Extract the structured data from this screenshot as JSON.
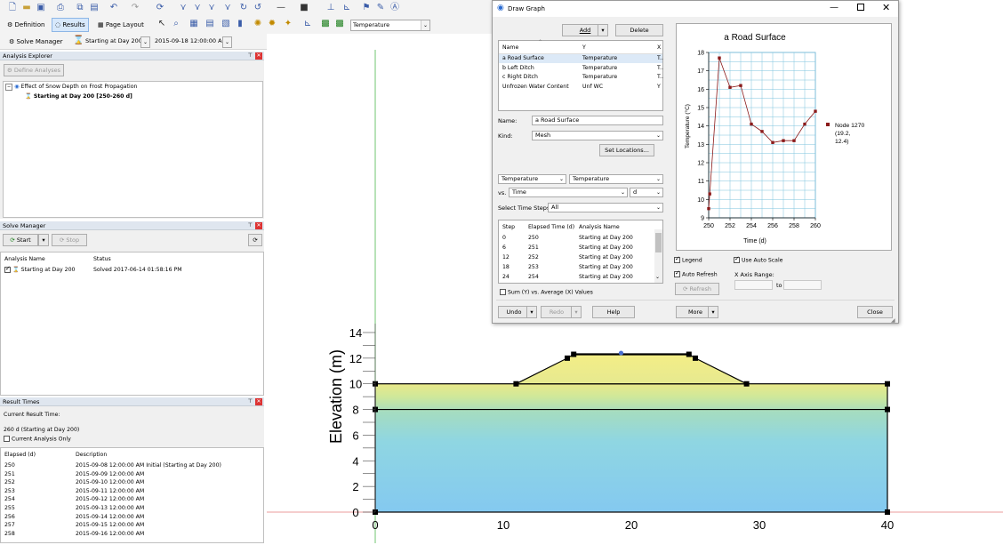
{
  "toolbar": {
    "definition_label": "Definition",
    "results_label": "Results",
    "page_layout_label": "Page Layout",
    "contour_combo_value": "Temperature",
    "solve_manager_label": "Solve Manager",
    "analysis_combo_value": "Starting at Day 200",
    "time_combo_value": "2015-09-18 12:00:00 A..."
  },
  "analysis_explorer": {
    "title": "Analysis Explorer",
    "define_button": "Define Analyses",
    "project_name": "Effect of Snow Depth on Frost Propagation",
    "analysis_name": "Starting at Day 200 [250-260 d]"
  },
  "solve_manager": {
    "title": "Solve Manager",
    "start_label": "Start",
    "stop_label": "Stop",
    "col_name": "Analysis Name",
    "col_status": "Status",
    "rows": [
      {
        "name": "Starting at Day 200",
        "status": "Solved 2017-06-14 01:58:16 PM"
      }
    ]
  },
  "result_times": {
    "title": "Result Times",
    "current_label": "Current Result Time:",
    "current_value": "260 d (Starting at Day 200)",
    "current_only_label": "Current Analysis Only",
    "col_elapsed": "Elapsed (d)",
    "col_description": "Description",
    "rows": [
      {
        "elapsed": "250",
        "description": "2015-09-08 12:00:00 AM Initial (Starting at Day 200)"
      },
      {
        "elapsed": "251",
        "description": "2015-09-09 12:00:00 AM"
      },
      {
        "elapsed": "252",
        "description": "2015-09-10 12:00:00 AM"
      },
      {
        "elapsed": "253",
        "description": "2015-09-11 12:00:00 AM"
      },
      {
        "elapsed": "254",
        "description": "2015-09-12 12:00:00 AM"
      },
      {
        "elapsed": "255",
        "description": "2015-09-13 12:00:00 AM"
      },
      {
        "elapsed": "256",
        "description": "2015-09-14 12:00:00 AM"
      },
      {
        "elapsed": "257",
        "description": "2015-09-15 12:00:00 AM"
      },
      {
        "elapsed": "258",
        "description": "2015-09-16 12:00:00 AM"
      }
    ]
  },
  "draw_graph": {
    "title": "Draw Graph",
    "add_label": "Add",
    "delete_label": "Delete",
    "list_headers": {
      "name": "Name",
      "y": "Y",
      "x": "X"
    },
    "graphs": [
      {
        "name": "a Road Surface",
        "y": "Temperature",
        "x": "T.."
      },
      {
        "name": "b Left Ditch",
        "y": "Temperature",
        "x": "T.."
      },
      {
        "name": "c Right Ditch",
        "y": "Temperature",
        "x": "T.."
      },
      {
        "name": "Unfrozen Water Content",
        "y": "Unf WC",
        "x": "Y"
      }
    ],
    "name_label": "Name:",
    "name_value": "a Road Surface",
    "kind_label": "Kind:",
    "kind_value": "Mesh",
    "set_locations_label": "Set Locations...",
    "y_category": "Temperature",
    "y_variable": "Temperature",
    "vs_label": "vs.",
    "x_variable": "Time",
    "x_unit": "d",
    "steps_label": "Select Time Steps:",
    "steps_value": "All",
    "step_headers": {
      "step": "Step",
      "elapsed": "Elapsed Time (d)",
      "analysis": "Analysis Name"
    },
    "steps": [
      {
        "step": "0",
        "elapsed": "250",
        "analysis": "Starting at Day 200"
      },
      {
        "step": "6",
        "elapsed": "251",
        "analysis": "Starting at Day 200"
      },
      {
        "step": "12",
        "elapsed": "252",
        "analysis": "Starting at Day 200"
      },
      {
        "step": "18",
        "elapsed": "253",
        "analysis": "Starting at Day 200"
      },
      {
        "step": "24",
        "elapsed": "254",
        "analysis": "Starting at Day 200"
      }
    ],
    "sum_avg_label": "Sum (Y) vs. Average (X) Values",
    "legend_label": "Legend",
    "auto_scale_label": "Use Auto Scale",
    "auto_refresh_label": "Auto Refresh",
    "x_range_label": "X Axis Range:",
    "to_label": "to",
    "refresh_label": "Refresh",
    "undo_label": "Undo",
    "redo_label": "Redo",
    "help_label": "Help",
    "more_label": "More",
    "close_label": "Close",
    "chart_data": {
      "type": "line",
      "title": "a Road Surface",
      "xlabel": "Time (d)",
      "ylabel": "Temperature (°C)",
      "xlim": [
        250,
        260
      ],
      "ylim": [
        9,
        18
      ],
      "xticks": [
        250,
        252,
        254,
        256,
        258,
        260
      ],
      "yticks": [
        9,
        10,
        11,
        12,
        13,
        14,
        15,
        16,
        17,
        18
      ],
      "grid": true,
      "legend_position": "right",
      "series": [
        {
          "name": "Node 1270 (19.2, 12.4)",
          "color": "#8b1a1a",
          "x": [
            250,
            250.1,
            251,
            252,
            253,
            254,
            255,
            256,
            257,
            258,
            259,
            260
          ],
          "y": [
            9.5,
            10.3,
            17.7,
            16.1,
            16.2,
            14.1,
            13.7,
            13.1,
            13.2,
            13.2,
            14.1,
            14.8
          ]
        }
      ]
    }
  },
  "geometry_plot": {
    "ylabel": "Elevation (m)",
    "xlim": [
      0,
      40
    ],
    "ylim": [
      0,
      14
    ],
    "xticks": [
      0,
      10,
      20,
      30,
      40
    ],
    "yticks": [
      0,
      2,
      4,
      6,
      8,
      10,
      12,
      14
    ]
  }
}
